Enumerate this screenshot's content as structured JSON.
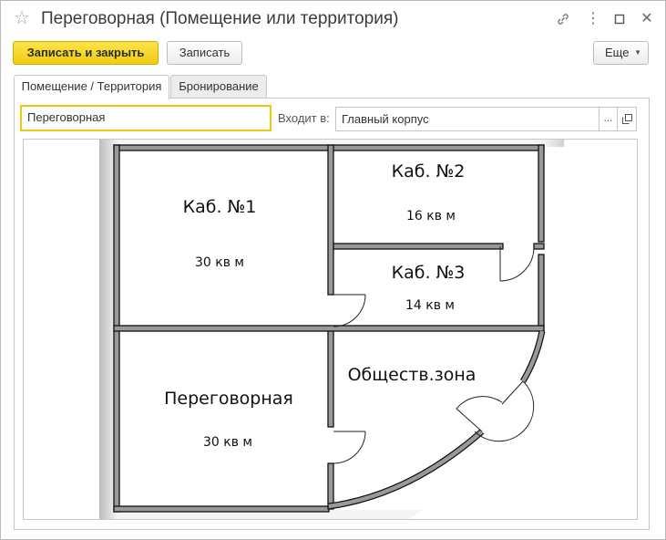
{
  "window": {
    "title": "Переговорная (Помещение или территория)"
  },
  "toolbar": {
    "save_close_label": "Записать и закрыть",
    "save_label": "Записать",
    "more_label": "Еще"
  },
  "tabs": [
    {
      "label": "Помещение / Территория",
      "active": true
    },
    {
      "label": "Бронирование",
      "active": false
    }
  ],
  "form": {
    "name_value": "Переговорная",
    "parent_label": "Входит в:",
    "parent_value": "Главный корпус",
    "select_button": "...",
    "open_button": "⧉"
  },
  "floor_plan": {
    "rooms": [
      {
        "name": "Каб. №1",
        "area": "30 кв м"
      },
      {
        "name": "Каб. №2",
        "area": "16 кв м"
      },
      {
        "name": "Каб. №3",
        "area": "14 кв м"
      },
      {
        "name": "Переговорная",
        "area": "30 кв м"
      },
      {
        "name": "Обществ.зона",
        "area": ""
      }
    ]
  },
  "colors": {
    "primary_button": "#f5d21e",
    "focus_border": "#f0c814"
  }
}
